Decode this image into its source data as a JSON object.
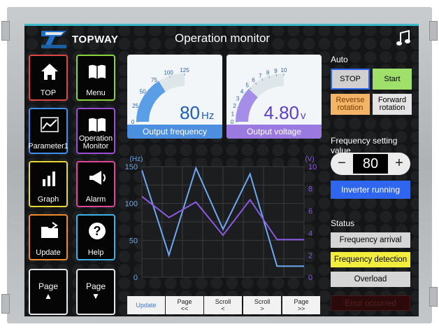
{
  "header": {
    "brand": "TOPWAY",
    "logo_text": "TOPWAY",
    "title": "Operation monitor",
    "music_icon": "music-note-icon"
  },
  "nav": [
    {
      "id": "top",
      "label": "TOP",
      "border": "#e04545",
      "icon": "home-icon"
    },
    {
      "id": "menu",
      "label": "Menu",
      "border": "#88d23a",
      "icon": "book-icon"
    },
    {
      "id": "parameter1",
      "label": "Parameter1",
      "border": "#3f8ff0",
      "icon": "line-chart-icon"
    },
    {
      "id": "operation-monitor",
      "label": "Operation Monitor",
      "border": "#9b4fd6",
      "icon": "book-icon"
    },
    {
      "id": "graph",
      "label": "Graph",
      "border": "#e6d832",
      "icon": "bar-chart-icon"
    },
    {
      "id": "alarm",
      "label": "Alarm",
      "border": "#e0459a",
      "icon": "megaphone-icon"
    },
    {
      "id": "update",
      "label": "Update",
      "border": "#f08a2e",
      "icon": "folder-icon"
    },
    {
      "id": "help",
      "label": "Help",
      "border": "#3fb0e6",
      "icon": "question-icon"
    }
  ],
  "page_buttons": [
    {
      "label": "Page",
      "arrow": "▲"
    },
    {
      "label": "Page",
      "arrow": "▼"
    }
  ],
  "gauges": [
    {
      "id": "frequency",
      "caption": "Output frequency",
      "value": "80",
      "unit": "Hz",
      "ticks": [
        "0",
        "25",
        "50",
        "75",
        "100",
        "125"
      ],
      "min": 0,
      "max": 125,
      "reading": 80,
      "arc_color": "#5b9ee8",
      "value_color": "#1d5fb8",
      "cap_color": "#4c8ee0"
    },
    {
      "id": "voltage",
      "caption": "Output voltage",
      "value": "4.80",
      "unit": "v",
      "ticks": [
        "0",
        "1",
        "2",
        "3",
        "4",
        "5",
        "6",
        "7",
        "8",
        "9",
        "10"
      ],
      "min": 0,
      "max": 10,
      "reading": 4.8,
      "arc_color": "#a58ee8",
      "value_color": "#5d3fc8",
      "cap_color": "#9a7ae0"
    }
  ],
  "auto": {
    "label": "Auto",
    "stop": "STOP",
    "start": "Start",
    "reverse": "Reverse rotation",
    "forward": "Forward rotation",
    "colors": {
      "stop": "#d0d0d0",
      "start": "#9ee06a",
      "reverse": "#f2b466",
      "forward": "#e4e4e4"
    }
  },
  "frequency_setting": {
    "label": "Frequency setting value",
    "value": "80",
    "minus": "−",
    "plus": "+"
  },
  "inverter": {
    "label": "Inverter running"
  },
  "status": {
    "label": "Status",
    "items": [
      "Frequency arrival",
      "Frequency detection",
      "Overload",
      "Error occurred"
    ],
    "colors": [
      "#d6d6d6",
      "#f3ee3e",
      "#d6d6d6",
      "#2a0a0a"
    ]
  },
  "bottom_buttons": [
    "Update",
    "Page\n<<",
    "Scroll\n<",
    "Scroll\n>",
    "Page\n>>"
  ],
  "chart_data": {
    "type": "line",
    "y_left_label": "(Hz)",
    "y_right_label": "(V)",
    "y_left_ticks": [
      "0",
      "50",
      "100",
      "150"
    ],
    "y_right_ticks": [
      "0",
      "2",
      "4",
      "6",
      "8",
      "10"
    ],
    "ylim_left": [
      0,
      150
    ],
    "ylim_right": [
      0,
      10
    ],
    "x": [
      0,
      1,
      2,
      3,
      4,
      5,
      6
    ],
    "series": [
      {
        "color": "#6fa8f0",
        "axis": "left",
        "values": [
          145,
          30,
          148,
          65,
          140,
          15,
          15
        ]
      },
      {
        "color": "#8a5ae0",
        "axis": "right",
        "values": [
          7.3,
          5.4,
          6.8,
          3.8,
          7.0,
          3.4,
          3.4
        ]
      }
    ],
    "grid": true
  }
}
